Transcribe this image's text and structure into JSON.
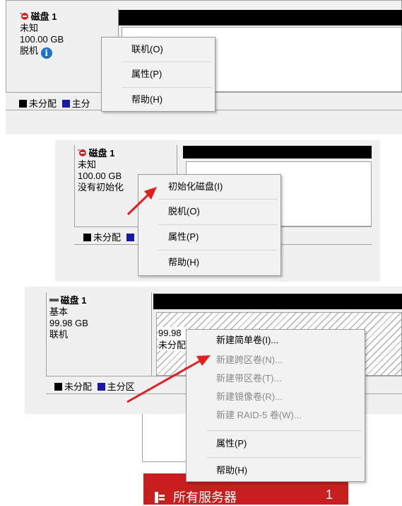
{
  "panel1": {
    "disk_title": "磁盘 1",
    "disk_type": "未知",
    "disk_size": "100.00 GB",
    "disk_status": "脱机",
    "legend_unallocated": "未分配",
    "legend_primary": "主分",
    "menu": [
      {
        "label": "联机(O)"
      },
      {
        "label": "属性(P)"
      },
      {
        "label": "帮助(H)"
      }
    ]
  },
  "panel2": {
    "disk_title": "磁盘 1",
    "disk_type": "未知",
    "disk_size": "100.00 GB",
    "disk_status": "没有初始化",
    "legend_unallocated": "未分配",
    "menu": [
      {
        "label": "初始化磁盘(I)"
      },
      {
        "label": "脱机(O)"
      },
      {
        "label": "属性(P)"
      },
      {
        "label": "帮助(H)"
      }
    ]
  },
  "panel3": {
    "disk_title": "磁盘 1",
    "disk_type": "基本",
    "disk_size": "99.98 GB",
    "disk_status": "联机",
    "volume_size": "99.98",
    "volume_status": "未分配",
    "legend_unallocated": "未分配",
    "legend_primary": "主分区",
    "menu": [
      {
        "label": "新建简单卷(I)...",
        "enabled": true
      },
      {
        "label": "新建跨区卷(N)...",
        "enabled": false
      },
      {
        "label": "新建带区卷(T)...",
        "enabled": false
      },
      {
        "label": "新建镜像卷(R)...",
        "enabled": false
      },
      {
        "label": "新建 RAID-5 卷(W)...",
        "enabled": false
      },
      {
        "label": "属性(P)",
        "enabled": true
      },
      {
        "label": "帮助(H)",
        "enabled": true
      }
    ],
    "server_banner": {
      "label": "所有服务器",
      "count": "1"
    }
  },
  "colors": {
    "arrow": "#e02020",
    "primary_partition": "#1919a8",
    "banner": "#c81e1e"
  }
}
